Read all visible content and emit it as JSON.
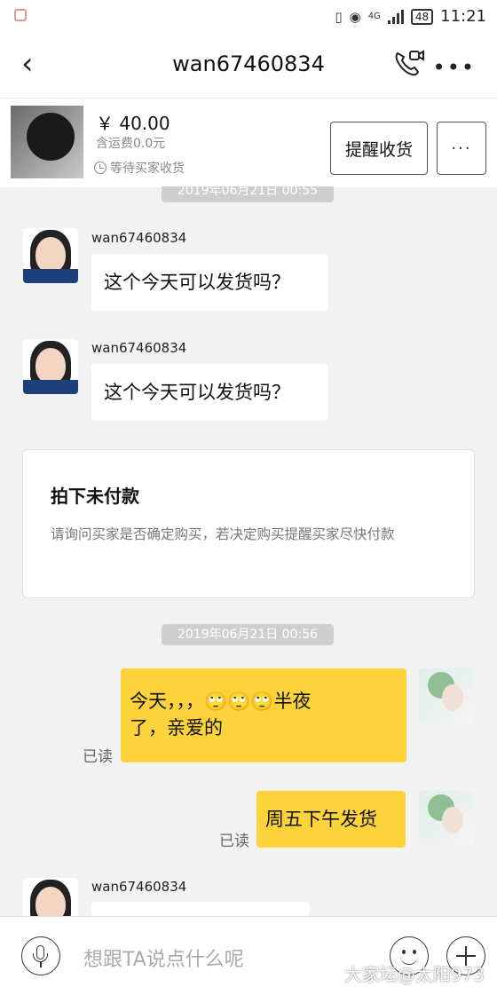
{
  "status_bar": {
    "time": "11:21",
    "network": "4G",
    "battery": "48"
  },
  "header": {
    "title": "wan67460834"
  },
  "order": {
    "price": "￥ 40.00",
    "shipping": "含运费0.0元",
    "status": "等待买家收货",
    "remind_button": "提醒收货",
    "more_button": "···"
  },
  "chat": {
    "timestamp_top": "2019年06月21日 00:55",
    "messages_left": [
      {
        "sender": "wan67460834",
        "text": "这个今天可以发货吗？"
      },
      {
        "sender": "wan67460834",
        "text": "这个今天可以发货吗？"
      },
      {
        "sender": "wan67460834",
        "text": ""
      }
    ],
    "card": {
      "title": "拍下未付款",
      "body": "请询问买家是否确定购买，若决定购买提醒买家尽快付款"
    },
    "timestamp_2": "2019年06月21日 00:56",
    "messages_right": [
      {
        "line1": "今天，，，🙄🙄🙄半夜",
        "line2": "了，亲爱的",
        "status": "已读"
      },
      {
        "text": "周五下午发货",
        "status": "已读"
      }
    ]
  },
  "input": {
    "placeholder": "想跟TA说点什么呢"
  },
  "watermark": "大家坛@太阳973"
}
